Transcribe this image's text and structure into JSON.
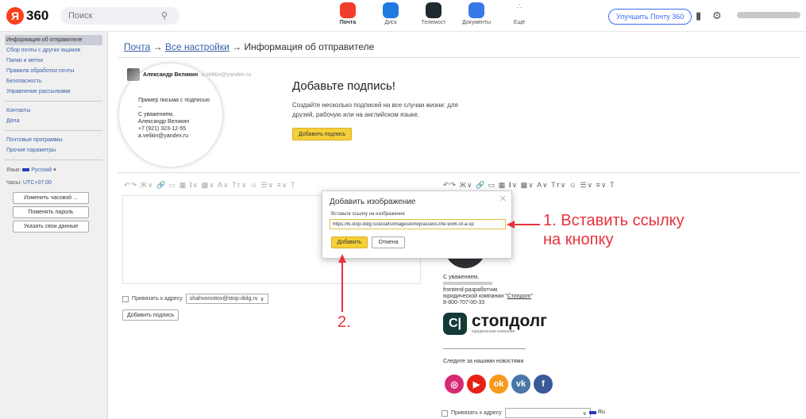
{
  "header": {
    "logo_letter": "Я",
    "logo_text": "360",
    "search_placeholder": "Поиск",
    "search_icon": "magnifier-icon",
    "apps": [
      {
        "label": "Почта",
        "color": "#f23c2c",
        "active": true
      },
      {
        "label": "Диск",
        "color": "#1f7ae0",
        "active": false
      },
      {
        "label": "Телемост",
        "color": "#1f2a2e",
        "active": false
      },
      {
        "label": "Документы",
        "color": "#3b78e7",
        "active": false
      },
      {
        "label": "Ещё",
        "color": "#ffffff",
        "active": false
      }
    ],
    "upgrade_label": "Улучшить Почту 360",
    "phone_icon": "phone-icon",
    "settings_icon": "gear-icon"
  },
  "sidebar": {
    "items_group1": [
      {
        "label": "Информация об отправителе",
        "active": true
      },
      {
        "label": "Сбор почты с других ящиков"
      },
      {
        "label": "Папки и метки"
      },
      {
        "label": "Правила обработки почты"
      },
      {
        "label": "Безопасность"
      },
      {
        "label": "Управление рассылками"
      }
    ],
    "items_group2": [
      {
        "label": "Контакты"
      },
      {
        "label": "Дела"
      }
    ],
    "items_group3": [
      {
        "label": "Почтовые программы"
      },
      {
        "label": "Прочие параметры"
      }
    ],
    "lang_label": "Язык:",
    "lang_value": "Русский",
    "time_label": "Часы:",
    "time_value": "UTC+07:00",
    "buttons": [
      "Изменить часовой ...",
      "Поменять пароль",
      "Указать свои данные"
    ]
  },
  "breadcrumb": {
    "part1": "Почта",
    "sep": " → ",
    "part2": "Все настройки",
    "part3": "Информация об отправителе"
  },
  "promo": {
    "name": "Александр Великин",
    "email": "a.velikin@yandex.ru",
    "sig_lines": [
      "Пример письма с подписью",
      "--",
      "С уважением,",
      "Александр Великин",
      "+7 (921) 323-12-55",
      "a.velikin@yandex.ru"
    ],
    "title": "Добавьте подпись!",
    "desc": "Создайте несколько подписей на все случаи жизни: для друзей, рабочую или на английском языке.",
    "button": "Добавить подпись"
  },
  "editor_left": {
    "toolbar": "↶↷ Ж∨ 🔗 ▭ ▦ 𝐈∨ ▩∨ A∨ Tт∨ ☺ ☰∨ ≡∨ T",
    "bind_label": "Привязать к адресу",
    "bind_value": "shahvorostov@stop-dolg.ru",
    "add_button": "Добавить подпись"
  },
  "editor_right": {
    "toolbar": "↶↷ Ж∨ 🔗 ▭ ▦ 𝐈∨ ▩∨ A∨ Tт∨ ☺ ☰∨ ≡∨ T",
    "sig_greeting": "С уважением,",
    "sig_role": "frontend-разработчик",
    "sig_company_prefix": "юридической компании \"",
    "sig_company": "Стопдолг",
    "sig_company_suffix": "\"",
    "sig_phone": "8-800-707-00-33",
    "brand_name": "стопдолг",
    "brand_sub": "юридическая компания",
    "follow": "Следите за нашими новостями",
    "socials": [
      {
        "name": "instagram-icon",
        "glyph": "◎",
        "color": "#d62976"
      },
      {
        "name": "youtube-icon",
        "glyph": "▶",
        "color": "#e62117"
      },
      {
        "name": "odnoklassniki-icon",
        "glyph": "ok",
        "color": "#f59a1e"
      },
      {
        "name": "vk-icon",
        "glyph": "vk",
        "color": "#4a76a8"
      },
      {
        "name": "facebook-icon",
        "glyph": "f",
        "color": "#3b5998"
      }
    ],
    "bind_label": "Привязать к адресу",
    "lang": "Ru"
  },
  "modal": {
    "title": "Добавить изображение",
    "label": "Вставьте ссылку на изображение",
    "url": "https://lk.stop-dolg.ru/assets/images/emoji/assess-the-work-of-a-sp",
    "add": "Добавить",
    "cancel": "Отмена"
  },
  "annotations": {
    "step1_line1": "1. Вставить ссылку",
    "step1_line2": "на кнопку",
    "step2": "2.",
    "color": "#e8323c"
  }
}
